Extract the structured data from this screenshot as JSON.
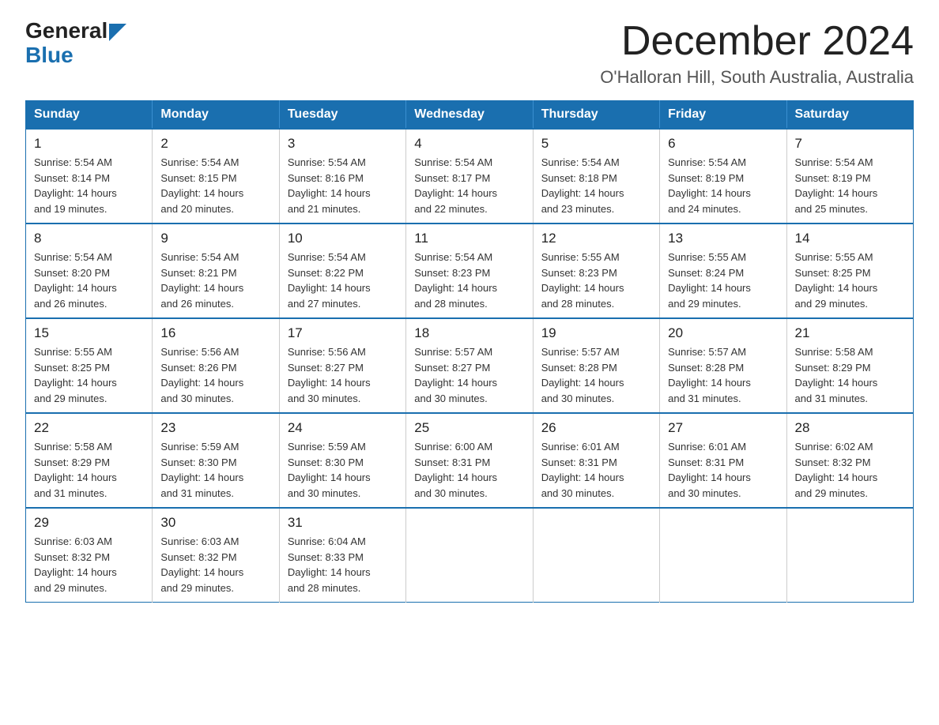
{
  "logo": {
    "text_general": "General",
    "text_blue": "Blue",
    "tagline": ""
  },
  "header": {
    "title": "December 2024",
    "subtitle": "O'Halloran Hill, South Australia, Australia"
  },
  "weekdays": [
    "Sunday",
    "Monday",
    "Tuesday",
    "Wednesday",
    "Thursday",
    "Friday",
    "Saturday"
  ],
  "weeks": [
    [
      {
        "day": "1",
        "sunrise": "5:54 AM",
        "sunset": "8:14 PM",
        "daylight": "14 hours and 19 minutes."
      },
      {
        "day": "2",
        "sunrise": "5:54 AM",
        "sunset": "8:15 PM",
        "daylight": "14 hours and 20 minutes."
      },
      {
        "day": "3",
        "sunrise": "5:54 AM",
        "sunset": "8:16 PM",
        "daylight": "14 hours and 21 minutes."
      },
      {
        "day": "4",
        "sunrise": "5:54 AM",
        "sunset": "8:17 PM",
        "daylight": "14 hours and 22 minutes."
      },
      {
        "day": "5",
        "sunrise": "5:54 AM",
        "sunset": "8:18 PM",
        "daylight": "14 hours and 23 minutes."
      },
      {
        "day": "6",
        "sunrise": "5:54 AM",
        "sunset": "8:19 PM",
        "daylight": "14 hours and 24 minutes."
      },
      {
        "day": "7",
        "sunrise": "5:54 AM",
        "sunset": "8:19 PM",
        "daylight": "14 hours and 25 minutes."
      }
    ],
    [
      {
        "day": "8",
        "sunrise": "5:54 AM",
        "sunset": "8:20 PM",
        "daylight": "14 hours and 26 minutes."
      },
      {
        "day": "9",
        "sunrise": "5:54 AM",
        "sunset": "8:21 PM",
        "daylight": "14 hours and 26 minutes."
      },
      {
        "day": "10",
        "sunrise": "5:54 AM",
        "sunset": "8:22 PM",
        "daylight": "14 hours and 27 minutes."
      },
      {
        "day": "11",
        "sunrise": "5:54 AM",
        "sunset": "8:23 PM",
        "daylight": "14 hours and 28 minutes."
      },
      {
        "day": "12",
        "sunrise": "5:55 AM",
        "sunset": "8:23 PM",
        "daylight": "14 hours and 28 minutes."
      },
      {
        "day": "13",
        "sunrise": "5:55 AM",
        "sunset": "8:24 PM",
        "daylight": "14 hours and 29 minutes."
      },
      {
        "day": "14",
        "sunrise": "5:55 AM",
        "sunset": "8:25 PM",
        "daylight": "14 hours and 29 minutes."
      }
    ],
    [
      {
        "day": "15",
        "sunrise": "5:55 AM",
        "sunset": "8:25 PM",
        "daylight": "14 hours and 29 minutes."
      },
      {
        "day": "16",
        "sunrise": "5:56 AM",
        "sunset": "8:26 PM",
        "daylight": "14 hours and 30 minutes."
      },
      {
        "day": "17",
        "sunrise": "5:56 AM",
        "sunset": "8:27 PM",
        "daylight": "14 hours and 30 minutes."
      },
      {
        "day": "18",
        "sunrise": "5:57 AM",
        "sunset": "8:27 PM",
        "daylight": "14 hours and 30 minutes."
      },
      {
        "day": "19",
        "sunrise": "5:57 AM",
        "sunset": "8:28 PM",
        "daylight": "14 hours and 30 minutes."
      },
      {
        "day": "20",
        "sunrise": "5:57 AM",
        "sunset": "8:28 PM",
        "daylight": "14 hours and 31 minutes."
      },
      {
        "day": "21",
        "sunrise": "5:58 AM",
        "sunset": "8:29 PM",
        "daylight": "14 hours and 31 minutes."
      }
    ],
    [
      {
        "day": "22",
        "sunrise": "5:58 AM",
        "sunset": "8:29 PM",
        "daylight": "14 hours and 31 minutes."
      },
      {
        "day": "23",
        "sunrise": "5:59 AM",
        "sunset": "8:30 PM",
        "daylight": "14 hours and 31 minutes."
      },
      {
        "day": "24",
        "sunrise": "5:59 AM",
        "sunset": "8:30 PM",
        "daylight": "14 hours and 30 minutes."
      },
      {
        "day": "25",
        "sunrise": "6:00 AM",
        "sunset": "8:31 PM",
        "daylight": "14 hours and 30 minutes."
      },
      {
        "day": "26",
        "sunrise": "6:01 AM",
        "sunset": "8:31 PM",
        "daylight": "14 hours and 30 minutes."
      },
      {
        "day": "27",
        "sunrise": "6:01 AM",
        "sunset": "8:31 PM",
        "daylight": "14 hours and 30 minutes."
      },
      {
        "day": "28",
        "sunrise": "6:02 AM",
        "sunset": "8:32 PM",
        "daylight": "14 hours and 29 minutes."
      }
    ],
    [
      {
        "day": "29",
        "sunrise": "6:03 AM",
        "sunset": "8:32 PM",
        "daylight": "14 hours and 29 minutes."
      },
      {
        "day": "30",
        "sunrise": "6:03 AM",
        "sunset": "8:32 PM",
        "daylight": "14 hours and 29 minutes."
      },
      {
        "day": "31",
        "sunrise": "6:04 AM",
        "sunset": "8:33 PM",
        "daylight": "14 hours and 28 minutes."
      },
      null,
      null,
      null,
      null
    ]
  ],
  "labels": {
    "sunrise": "Sunrise:",
    "sunset": "Sunset:",
    "daylight": "Daylight:"
  }
}
